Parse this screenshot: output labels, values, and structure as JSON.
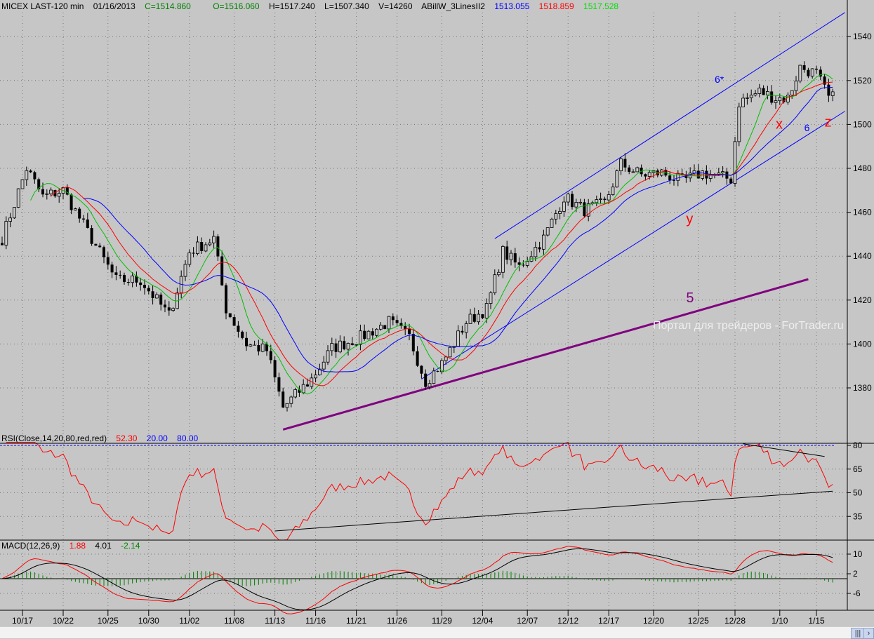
{
  "header": {
    "symbol": "MICEX LAST-120 min",
    "date": "01/16/2013",
    "close": "C=1514.860",
    "open": "O=1516.060",
    "high": "H=1517.240",
    "low": "L=1507.340",
    "volume": "V=14260",
    "indicator": "ABillW_3LinesII2",
    "line_blue": "1513.055",
    "line_red": "1518.859",
    "line_green": "1517.528"
  },
  "rsi_header": {
    "label": "RSI(Close,14,20,80,red,red)",
    "value": "52.30",
    "low": "20.00",
    "high": "80.00"
  },
  "macd_header": {
    "label": "MACD(12,26,9)",
    "macd": "1.88",
    "signal": "4.01",
    "hist": "-2.14"
  },
  "watermark": "Портал для трейдеров - ForTrader.ru",
  "colors": {
    "bg": "#c6c6c6",
    "green": "#00c000",
    "red": "#ff0000",
    "blue": "#0000ff",
    "purple": "#800080",
    "hist": "#008000"
  },
  "chart_data": {
    "type": "candlestick",
    "bar_count": 205,
    "price_anchors": [
      [
        0,
        1448
      ],
      [
        6,
        1480
      ],
      [
        10,
        1467
      ],
      [
        15,
        1470
      ],
      [
        21,
        1451
      ],
      [
        28,
        1429
      ],
      [
        34,
        1429
      ],
      [
        41,
        1413
      ],
      [
        46,
        1442
      ],
      [
        52,
        1448
      ],
      [
        55,
        1416
      ],
      [
        60,
        1400
      ],
      [
        65,
        1397
      ],
      [
        69,
        1371
      ],
      [
        76,
        1384
      ],
      [
        81,
        1398
      ],
      [
        88,
        1403
      ],
      [
        95,
        1410
      ],
      [
        100,
        1403
      ],
      [
        104,
        1383
      ],
      [
        108,
        1391
      ],
      [
        114,
        1410
      ],
      [
        119,
        1416
      ],
      [
        123,
        1442
      ],
      [
        127,
        1435
      ],
      [
        133,
        1448
      ],
      [
        138,
        1467
      ],
      [
        143,
        1461
      ],
      [
        148,
        1464
      ],
      [
        152,
        1482
      ],
      [
        157,
        1477
      ],
      [
        162,
        1478
      ],
      [
        167,
        1474
      ],
      [
        172,
        1478
      ],
      [
        179,
        1475
      ],
      [
        181,
        1510
      ],
      [
        186,
        1515
      ],
      [
        190,
        1512
      ],
      [
        193,
        1512
      ],
      [
        196,
        1526
      ],
      [
        200,
        1523
      ],
      [
        203,
        1512
      ],
      [
        204,
        1514.86
      ]
    ],
    "price_ticks": [
      "1380",
      "1400",
      "1420",
      "1440",
      "1460",
      "1480",
      "1500",
      "1520",
      "1540"
    ],
    "price_range": [
      1355,
      1556
    ],
    "date_ticks": [
      [
        5,
        "10/17"
      ],
      [
        15,
        "10/22"
      ],
      [
        26,
        "10/25"
      ],
      [
        36,
        "10/30"
      ],
      [
        46,
        "11/02"
      ],
      [
        57,
        "11/08"
      ],
      [
        67,
        "11/13"
      ],
      [
        77,
        "11/16"
      ],
      [
        87,
        "11/21"
      ],
      [
        97,
        "11/26"
      ],
      [
        108,
        "11/29"
      ],
      [
        118,
        "12/04"
      ],
      [
        129,
        "12/07"
      ],
      [
        139,
        "12/12"
      ],
      [
        149,
        "12/17"
      ],
      [
        160,
        "12/20"
      ],
      [
        171,
        "12/25"
      ],
      [
        180,
        "12/28"
      ],
      [
        191,
        "1/10"
      ],
      [
        200,
        "1/15"
      ]
    ],
    "trendlines": [
      {
        "name": "5",
        "color": "#800080",
        "from": [
          69,
          1361
        ],
        "to": [
          198,
          1429.5
        ]
      },
      {
        "name": "6",
        "color": "#0000ff",
        "from": [
          103,
          1384
        ],
        "to": [
          207,
          1506
        ]
      },
      {
        "name": "6*",
        "color": "#0000ff",
        "from": [
          121,
          1448
        ],
        "to": [
          207,
          1551
        ]
      }
    ],
    "annotations": [
      {
        "text": "6*",
        "color": "#0000ff",
        "at": [
          175,
          1519
        ]
      },
      {
        "text": "6",
        "color": "#0000ff",
        "at": [
          197,
          1497
        ]
      },
      {
        "text": "5",
        "color": "#800080",
        "at": [
          168,
          1419
        ]
      },
      {
        "text": "x",
        "color": "#ff0000",
        "at": [
          190,
          1498
        ]
      },
      {
        "text": "y",
        "color": "#ff0000",
        "at": [
          168,
          1455
        ]
      },
      {
        "text": "z",
        "color": "#ff0000",
        "at": [
          202,
          1499
        ]
      }
    ],
    "moving_averages": [
      {
        "color": "#00c000",
        "period": 8
      },
      {
        "color": "#ff0000",
        "period": 13
      },
      {
        "color": "#0000ff",
        "period": 21
      }
    ],
    "rsi": {
      "period": 14,
      "ticks": [
        "80",
        "65",
        "50",
        "35"
      ],
      "levels": [
        20,
        80
      ],
      "trendlines": [
        {
          "from": [
            67,
            25.8
          ],
          "to": [
            204,
            51
          ]
        },
        {
          "from": [
            182,
            81
          ],
          "to": [
            202,
            73
          ]
        }
      ]
    },
    "macd": {
      "fast": 12,
      "slow": 26,
      "signal": 9,
      "ticks": [
        "10",
        "2",
        "-6"
      ]
    }
  }
}
